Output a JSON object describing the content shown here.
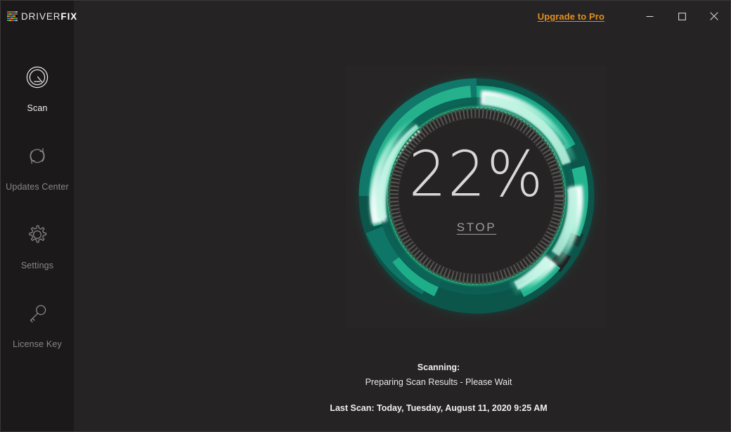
{
  "window": {
    "app_title": "DriverFix",
    "logo_text_light": "DRIVER",
    "logo_text_bold": "FIX",
    "upgrade_label": "Upgrade to Pro",
    "upgrade_color": "#e28f1f",
    "minimize_icon": "minimize-icon",
    "maximize_icon": "maximize-icon",
    "close_icon": "close-icon",
    "background_color": "#252323",
    "sidebar_color": "#1b1919"
  },
  "sidebar": {
    "items": [
      {
        "label": "Scan",
        "icon": "gauge-scan-icon",
        "active": true
      },
      {
        "label": "Updates Center",
        "icon": "refresh-circle-icon",
        "active": false
      },
      {
        "label": "Settings",
        "icon": "gear-icon",
        "active": false
      },
      {
        "label": "License Key",
        "icon": "key-icon",
        "active": false
      }
    ]
  },
  "scan": {
    "percent_label": "22%",
    "percent_value": 22,
    "stop_label": "STOP",
    "scanning_label": "Scanning:",
    "scanning_detail": "Preparing Scan Results - Please Wait",
    "last_scan": "Last Scan: Today, Tuesday, August 11, 2020 9:25 AM",
    "ring_colors": {
      "dark_teal": "#0a564c",
      "mid_teal": "#0d6b5e",
      "green": "#1fa884",
      "bright_mint": "#8fecd0",
      "glow_green": "#2ef0a0",
      "tick_ring": "#565252",
      "panel": "#272525"
    }
  }
}
